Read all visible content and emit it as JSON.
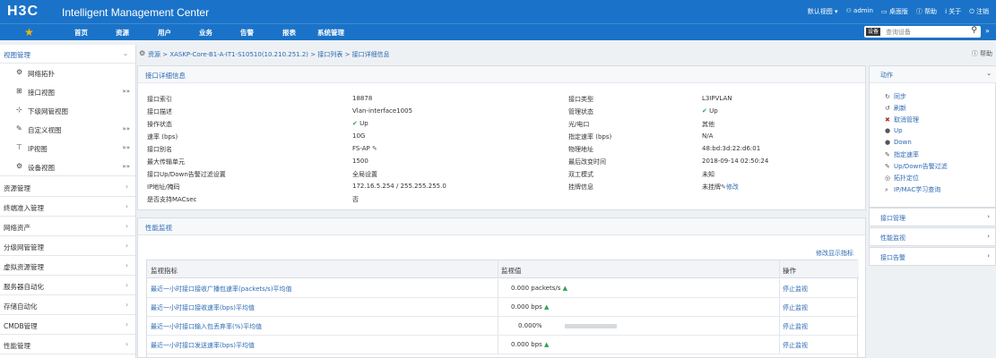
{
  "topbar": {
    "logo": "H3C",
    "title": "Intelligent Management Center",
    "right": [
      "默认视图 ▾",
      "admin",
      "桌面版",
      "帮助",
      "关于",
      "注销"
    ]
  },
  "nav": {
    "items": [
      "首页",
      "资源",
      "用户",
      "业务",
      "告警",
      "报表",
      "系统管理"
    ],
    "search": {
      "prefix": "设备",
      "placeholder": "查询设备"
    }
  },
  "sidebar": {
    "header": "视图管理",
    "sub": [
      {
        "label": "网络拓扑",
        "icon": "topology-icon",
        "chev": ""
      },
      {
        "label": "接口视图",
        "icon": "interface-view-icon",
        "chev": "»»"
      },
      {
        "label": "下级网管视图",
        "icon": "sub-nms-icon",
        "chev": ""
      },
      {
        "label": "自定义视图",
        "icon": "custom-view-icon",
        "chev": "»»"
      },
      {
        "label": "IP视图",
        "icon": "ip-view-icon",
        "chev": "»»"
      },
      {
        "label": "设备视图",
        "icon": "device-view-icon",
        "chev": "»»"
      }
    ],
    "groups": [
      "资源管理",
      "终端准入管理",
      "网络资产",
      "分级网管管理",
      "虚拟资源管理",
      "服务器自动化",
      "存储自动化",
      "CMDB管理",
      "性能管理"
    ]
  },
  "breadcrumb": {
    "path": "资源 > XASKP-Core-B1-A-IT1-S10510(10.210.251.2) > 接口列表 > 接口详细信息",
    "help": "帮助"
  },
  "detail": {
    "title": "接口详细信息",
    "left": [
      {
        "k": "接口索引",
        "v": "18878"
      },
      {
        "k": "接口描述",
        "v": "Vlan-interface1005"
      },
      {
        "k": "操作状态",
        "v": "Up",
        "status": "up"
      },
      {
        "k": "速率 (bps)",
        "v": "10G"
      },
      {
        "k": "接口别名",
        "v": "FS-AP",
        "edit": true
      },
      {
        "k": "最大传输单元",
        "v": "1500"
      },
      {
        "k": "接口Up/Down告警过滤设置",
        "v": "全局设置"
      },
      {
        "k": "IP地址/掩码",
        "v": "172.16.5.254 / 255.255.255.0"
      },
      {
        "k": "是否支持MACsec",
        "v": "否"
      }
    ],
    "right": [
      {
        "k": "接口类型",
        "v": "L3IPVLAN"
      },
      {
        "k": "管理状态",
        "v": "Up",
        "status": "up"
      },
      {
        "k": "光/电口",
        "v": "其他"
      },
      {
        "k": "指定速率 (bps)",
        "v": "N/A"
      },
      {
        "k": "物理地址",
        "v": "48:bd:3d:22:d6:01"
      },
      {
        "k": "最后改变时间",
        "v": "2018-09-14 02:50:24"
      },
      {
        "k": "双工模式",
        "v": "未知"
      },
      {
        "k": "挂牌信息",
        "v": "未挂牌",
        "link": "修改"
      }
    ]
  },
  "perf": {
    "title": "性能监视",
    "modify_link": "修改显示指标",
    "columns": [
      "监视指标",
      "监视值",
      "操作"
    ],
    "rows": [
      {
        "metric": "最近一小时接口接收广播包速率(packets/s)平均值",
        "value": "0.000 packets/s",
        "trend": "up",
        "action": "停止监视"
      },
      {
        "metric": "最近一小时接口接收速率(bps)平均值",
        "value": "0.000 bps",
        "trend": "up",
        "action": "停止监视"
      },
      {
        "metric": "最近一小时接口输入包丢弃率(%)平均值",
        "value": "0.000%",
        "progress": 0,
        "action": "停止监视"
      },
      {
        "metric": "最近一小时接口发送速率(bps)平均值",
        "value": "0.000 bps",
        "trend": "up",
        "action": "停止监视"
      }
    ]
  },
  "actions": {
    "title": "动作",
    "items": [
      {
        "label": "同步",
        "icon": "sync-icon",
        "glyph": "↻"
      },
      {
        "label": "刷新",
        "icon": "refresh-icon",
        "glyph": "↺"
      },
      {
        "label": "取消管理",
        "icon": "unmanage-icon",
        "glyph": "✖"
      },
      {
        "label": "Up",
        "icon": "up-icon",
        "glyph": "●"
      },
      {
        "label": "Down",
        "icon": "down-icon",
        "glyph": "●"
      },
      {
        "label": "指定速率",
        "icon": "set-rate-icon",
        "glyph": "✎"
      },
      {
        "label": "Up/Down告警过滤",
        "icon": "alarm-filter-icon",
        "glyph": "✎"
      },
      {
        "label": "拓扑定位",
        "icon": "topology-locate-icon",
        "glyph": "◎"
      },
      {
        "label": "IP/MAC学习查询",
        "icon": "ip-mac-query-icon",
        "glyph": "⌕"
      }
    ],
    "links": [
      "接口管理",
      "性能监视",
      "接口告警"
    ]
  },
  "colors": {
    "brand": "#1a73c8",
    "link": "#2c6ab3",
    "ok": "#2ea44f",
    "down": "#d93025"
  }
}
